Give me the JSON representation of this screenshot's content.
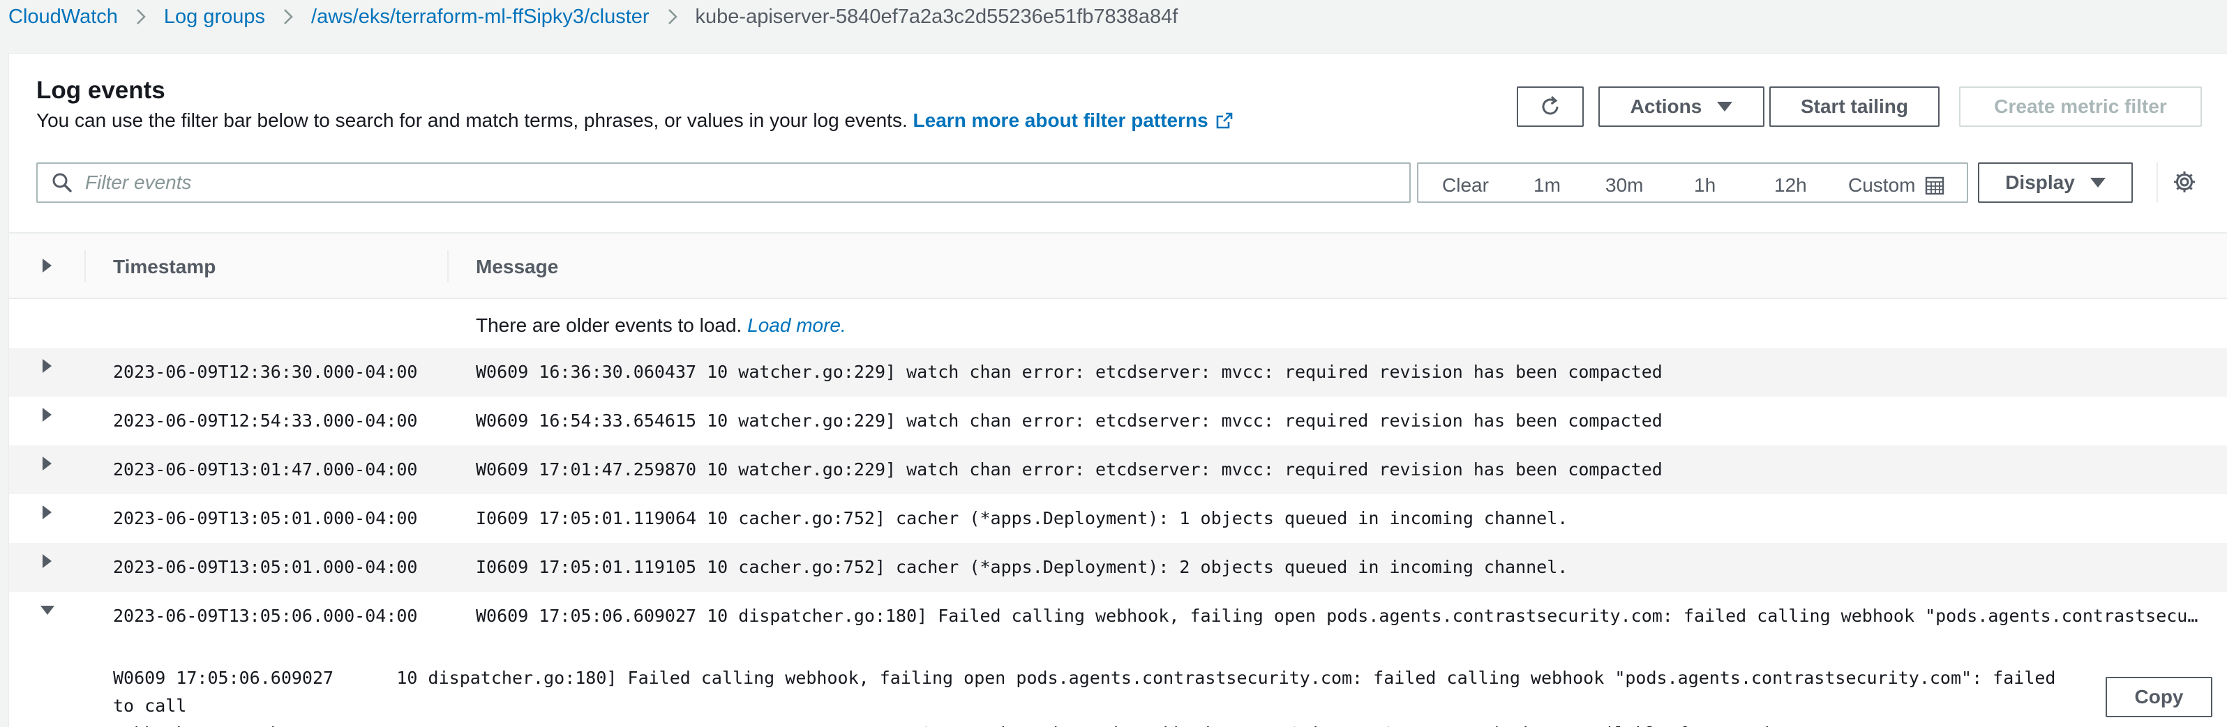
{
  "breadcrumb": {
    "items": [
      "CloudWatch",
      "Log groups",
      "/aws/eks/terraform-ml-ffSipky3/cluster"
    ],
    "current": "kube-apiserver-5840ef7a2a3c2d55236e51fb7838a84f"
  },
  "header": {
    "title": "Log events",
    "description": "You can use the filter bar below to search for and match terms, phrases, or values in your log events.",
    "learn_more": "Learn more about filter patterns"
  },
  "toolbar": {
    "actions_label": "Actions",
    "start_tailing_label": "Start tailing",
    "create_metric_filter_label": "Create metric filter",
    "display_label": "Display"
  },
  "filter": {
    "placeholder": "Filter events",
    "value": ""
  },
  "time_range": {
    "clear": "Clear",
    "options": [
      "1m",
      "30m",
      "1h",
      "12h"
    ],
    "custom": "Custom"
  },
  "table": {
    "columns": [
      "Timestamp",
      "Message"
    ],
    "older_events_text": "There are older events to load.",
    "load_more": "Load more.",
    "rows": [
      {
        "timestamp": "2023-06-09T12:36:30.000-04:00",
        "message": "W0609 16:36:30.060437 10 watcher.go:229] watch chan error: etcdserver: mvcc: required revision has been compacted"
      },
      {
        "timestamp": "2023-06-09T12:54:33.000-04:00",
        "message": "W0609 16:54:33.654615 10 watcher.go:229] watch chan error: etcdserver: mvcc: required revision has been compacted"
      },
      {
        "timestamp": "2023-06-09T13:01:47.000-04:00",
        "message": "W0609 17:01:47.259870 10 watcher.go:229] watch chan error: etcdserver: mvcc: required revision has been compacted"
      },
      {
        "timestamp": "2023-06-09T13:05:01.000-04:00",
        "message": "I0609 17:05:01.119064 10 cacher.go:752] cacher (*apps.Deployment): 1 objects queued in incoming channel."
      },
      {
        "timestamp": "2023-06-09T13:05:01.000-04:00",
        "message": "I0609 17:05:01.119105 10 cacher.go:752] cacher (*apps.Deployment): 2 objects queued in incoming channel."
      },
      {
        "timestamp": "2023-06-09T13:05:06.000-04:00",
        "message": "W0609 17:05:06.609027 10 dispatcher.go:180] Failed calling webhook, failing open pods.agents.contrastsecurity.com: failed calling webhook \"pods.agents.contrastsecurity.co…"
      }
    ],
    "expanded": {
      "detail": "W0609 17:05:06.609027      10 dispatcher.go:180] Failed calling webhook, failing open pods.agents.contrastsecurity.com: failed calling webhook \"pods.agents.contrastsecurity.com\": failed to call\nwebhook: Post \"https://contrast-agent-operator.contrast-agent-operator.svc:443/v1/pods/podmutationwebhook/mutate?timeout=2s\": no endpoints available for service \"contrast-agent-operator\"",
      "copy_label": "Copy"
    }
  },
  "icons": {
    "refresh": "refresh-icon",
    "external_link": "external-link-icon",
    "search": "search-icon",
    "calendar": "calendar-icon",
    "settings": "gear-icon"
  },
  "colors": {
    "link": "#0073bb",
    "text": "#16191f",
    "muted": "#545b64",
    "border": "#aab7b8",
    "disabled": "#aab7b8",
    "background": "#f2f3f3"
  }
}
